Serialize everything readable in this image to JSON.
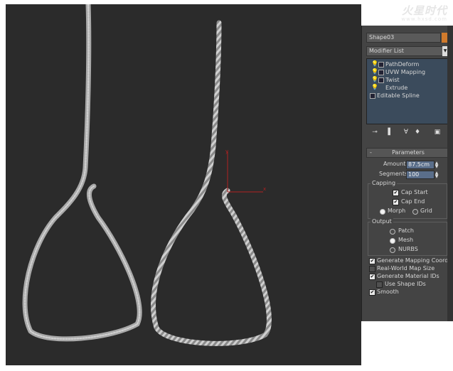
{
  "watermark": {
    "brand": "火星时代",
    "url": "www.hxsd.com"
  },
  "viewport": {
    "axis_x": "x",
    "axis_y": "y"
  },
  "panel": {
    "object_name": "Shape03",
    "modifier_list": "Modifier List",
    "stack": [
      {
        "label": "PathDeform"
      },
      {
        "label": "UVW Mapping"
      },
      {
        "label": "Twist"
      },
      {
        "label": "Extrude"
      },
      {
        "label": "Editable Spline"
      }
    ],
    "rollout_title": "Parameters",
    "amount_label": "Amount:",
    "amount_value": "87.5cm",
    "segments_label": "Segments:",
    "segments_value": "100",
    "capping": {
      "title": "Capping",
      "cap_start": "Cap Start",
      "cap_end": "Cap End",
      "morph": "Morph",
      "grid": "Grid"
    },
    "output": {
      "title": "Output",
      "patch": "Patch",
      "mesh": "Mesh",
      "nurbs": "NURBS"
    },
    "gen_mapping": "Generate Mapping Coords.",
    "real_world": "Real-World Map Size",
    "gen_material": "Generate Material IDs",
    "use_shape_ids": "Use Shape IDs",
    "smooth": "Smooth"
  }
}
